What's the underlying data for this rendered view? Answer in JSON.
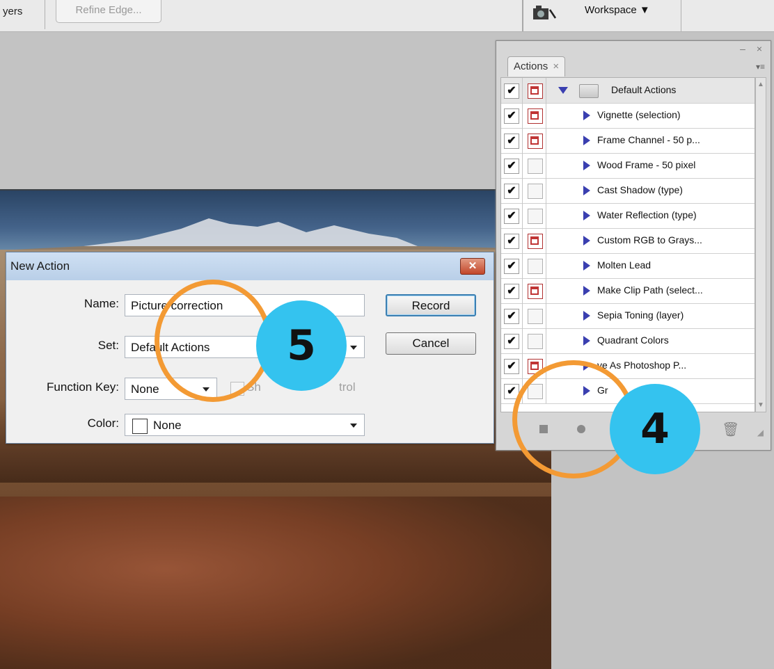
{
  "toolbar": {
    "layers_label": "yers",
    "refine_edge_label": "Refine Edge...",
    "workspace_label": "Workspace ▼"
  },
  "actions_panel": {
    "tab_label": "Actions",
    "tab_close": "×",
    "window_controls": "– ×",
    "menu_icon": "▾≡",
    "set_name": "Default Actions",
    "items": [
      {
        "label": "Vignette (selection)",
        "checked": true,
        "dialog": true
      },
      {
        "label": "Frame Channel - 50 p...",
        "checked": true,
        "dialog": true
      },
      {
        "label": "Wood Frame - 50 pixel",
        "checked": true,
        "dialog": false
      },
      {
        "label": "Cast Shadow (type)",
        "checked": true,
        "dialog": false
      },
      {
        "label": "Water Reflection (type)",
        "checked": true,
        "dialog": false
      },
      {
        "label": "Custom RGB to Grays...",
        "checked": true,
        "dialog": true
      },
      {
        "label": "Molten Lead",
        "checked": true,
        "dialog": false
      },
      {
        "label": "Make Clip Path (select...",
        "checked": true,
        "dialog": true
      },
      {
        "label": "Sepia Toning (layer)",
        "checked": true,
        "dialog": false
      },
      {
        "label": "Quadrant Colors",
        "checked": true,
        "dialog": false
      },
      {
        "label": "ve As Photoshop P...",
        "checked": true,
        "dialog": true
      },
      {
        "label": "Gr",
        "checked": true,
        "dialog": false
      }
    ],
    "check_glyph": "✔"
  },
  "dialog": {
    "title": "New Action",
    "close_glyph": "✕",
    "name_label": "Name:",
    "name_value": "Picture correction",
    "set_label": "Set:",
    "set_value": "Default Actions",
    "function_key_label": "Function Key:",
    "function_key_value": "None",
    "shift_label": "Sh",
    "control_label": "trol",
    "color_label": "Color:",
    "color_value": "None",
    "record_label": "Record",
    "cancel_label": "Cancel"
  },
  "annotations": {
    "step5": "5",
    "step4": "4",
    "ring_color": "#f39a34",
    "badge_color": "#34c3ef"
  }
}
